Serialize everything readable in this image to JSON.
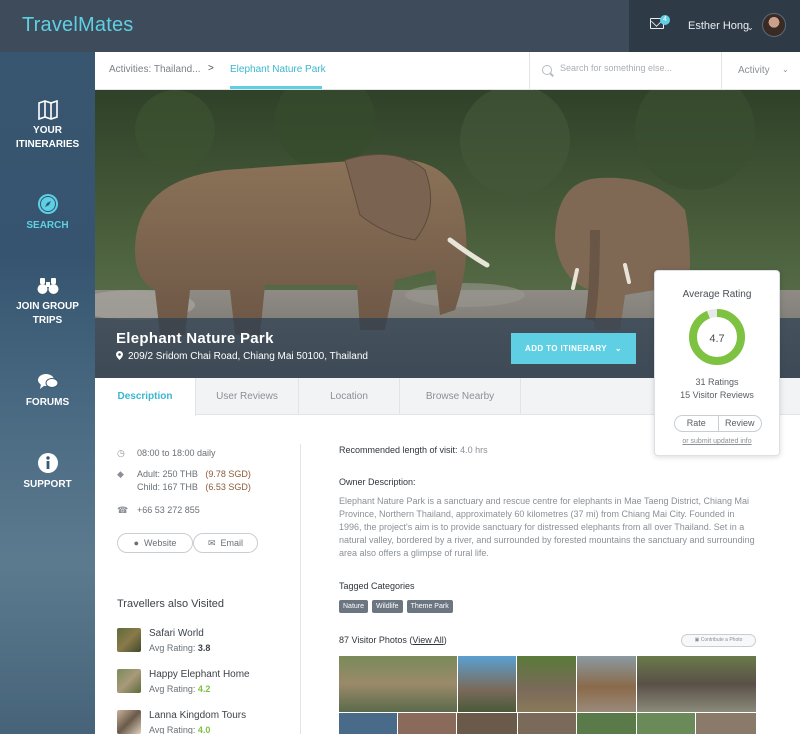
{
  "app": {
    "brand": "TravelMates"
  },
  "header": {
    "notifications_count": "4",
    "user_name": "Esther Hong"
  },
  "sidebar": {
    "items": [
      {
        "label_line1": "YOUR",
        "label_line2": "ITINERARIES",
        "icon": "map-icon",
        "active": false
      },
      {
        "label_line1": "SEARCH",
        "label_line2": "",
        "icon": "compass-icon",
        "active": true
      },
      {
        "label_line1": "JOIN GROUP",
        "label_line2": "TRIPS",
        "icon": "binoculars-icon",
        "active": false
      },
      {
        "label_line1": "FORUMS",
        "label_line2": "",
        "icon": "chat-icon",
        "active": false
      },
      {
        "label_line1": "SUPPORT",
        "label_line2": "",
        "icon": "info-icon",
        "active": false
      }
    ]
  },
  "breadcrumb": {
    "parent": "Activities: Thailand...",
    "separator": ">",
    "current": "Elephant Nature Park"
  },
  "search": {
    "placeholder": "Search for something else..."
  },
  "activity_dropdown": {
    "label": "Activity"
  },
  "hero": {
    "title": "Elephant Nature Park",
    "address": "209/2 Sridom Chai Road, Chiang Mai 50100, Thailand",
    "add_button": "ADD TO ITINERARY"
  },
  "rating": {
    "title": "Average Rating",
    "value": "4.7",
    "value_fraction": 0.94,
    "ratings_count": "31 Ratings",
    "reviews_count": "15 Visitor Reviews",
    "rate_label": "Rate",
    "review_label": "Review",
    "submit_link": "or submit updated info",
    "accent_color": "#7ec242"
  },
  "tabs": [
    {
      "label": "Description",
      "active": true
    },
    {
      "label": "User Reviews",
      "active": false
    },
    {
      "label": "Location",
      "active": false
    },
    {
      "label": "Browse Nearby",
      "active": false
    }
  ],
  "details": {
    "hours": "08:00 to 18:00 daily",
    "adult_price": "Adult: 250 THB",
    "adult_sgd": "(9.78 SGD)",
    "child_price": "Child: 167 THB",
    "child_sgd": "(6.53 SGD)",
    "phone": "+66 53 272 855",
    "website_label": "Website",
    "email_label": "Email"
  },
  "also_visited": {
    "title": "Travellers also Visited",
    "rating_prefix": "Avg Rating:",
    "items": [
      {
        "name": "Safari World",
        "rating": "3.8"
      },
      {
        "name": "Happy Elephant Home",
        "rating": "4.2"
      },
      {
        "name": "Lanna Kingdom Tours",
        "rating": "4.0"
      }
    ]
  },
  "description": {
    "rec_label": "Recommended length of visit:",
    "rec_value": "4.0 hrs",
    "owner_title": "Owner Description:",
    "owner_text": "Elephant Nature Park is a sanctuary and rescue centre for elephants in Mae Taeng District, Chiang Mai Province, Northern Thailand, approximately 60 kilometres (37 mi) from Chiang Mai City. Founded in 1996, the project's aim is to provide sanctuary for distressed elephants from all over Thailand. Set in a natural valley, bordered by a river, and surrounded by forested mountains the sanctuary and surrounding area also offers a glimpse of rural life.",
    "tags_title": "Tagged Categories",
    "tags": [
      "Nature",
      "Wildlife",
      "Theme Park"
    ],
    "photos_count": "87 Visitor Photos",
    "view_all": "View All",
    "contribute": "Contribute a Photo"
  }
}
